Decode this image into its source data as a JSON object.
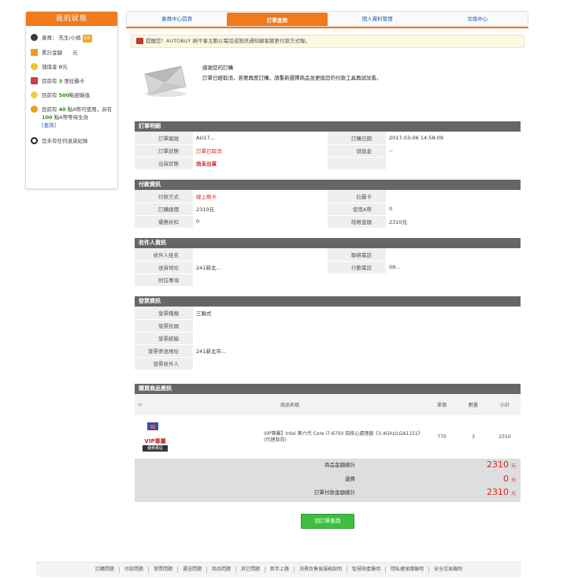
{
  "sidebar": {
    "title": "我的狀態",
    "member_prefix": "會員：",
    "member_name": "先生/小姐",
    "vip_badge": "VIP",
    "total_amount_label": "累計金額",
    "total_amount_unit": "元",
    "stored_value_label": "儲值金",
    "stored_value_amount": "0",
    "stored_value_unit": "元",
    "coupon_prefix": "目前有",
    "coupon_count": "3",
    "coupon_suffix": "張拉霸卡",
    "bonus_prefix": "目前有",
    "bonus_count": "500",
    "bonus_suffix": "點經驗值",
    "apoint_prefix": "目前有",
    "apoint_count": "40",
    "apoint_mid": "點A幣可使用，另有",
    "apoint_pending": "100",
    "apoint_suffix": "點A幣等待生效",
    "apoint_link": "[查詢]",
    "return_text": "您未有任何退貨紀錄"
  },
  "tabs": [
    {
      "label": "會員中心首頁"
    },
    {
      "label": "訂單查詢"
    },
    {
      "label": "個人資料管理"
    },
    {
      "label": "兌換中心"
    }
  ],
  "notice": "提醒您！AUTOBUY 絕不會主動以電話或簡訊通知顧客變更付款方式喔。",
  "thanks": {
    "line1": "感謝您的訂購",
    "line2": "訂單已經取消，若要再度訂購，請重新選擇商品並更換您的付款工具再試試看。"
  },
  "order_detail": {
    "title": "訂單明細",
    "rows": [
      {
        "l1": "訂單編號",
        "v1": "AU17...",
        "l2": "訂購日期",
        "v2": "2017-03-06 14:58:09"
      },
      {
        "l1": "訂單狀態",
        "v1": "訂單已取消",
        "l2": "儲值金",
        "v2": "--"
      },
      {
        "l1": "出貨狀態",
        "v1": "尚未出貨",
        "l2": "",
        "v2": ""
      }
    ]
  },
  "payment": {
    "title": "付款資訊",
    "rows": [
      {
        "l1": "付款方式",
        "v1": "線上刷卡",
        "l2": "拉霸卡",
        "v2": ""
      },
      {
        "l1": "訂購總價",
        "v1": "2310元",
        "l2": "使用A幣",
        "v2": "0"
      },
      {
        "l1": "優惠折扣",
        "v1": "0",
        "l2": "結帳金額",
        "v2": "2310元"
      }
    ]
  },
  "recipient": {
    "title": "收件人資訊",
    "name_label": "收件人姓名",
    "name_value": "",
    "phone_label": "聯絡電話",
    "phone_value": "",
    "address_label": "送貨地址",
    "address_value": "241新北...",
    "mobile_label": "行動電話",
    "mobile_value": "09...",
    "note_label": "附註事項",
    "note_value": ""
  },
  "invoice": {
    "title": "發票資訊",
    "rows": [
      {
        "label": "發票種類",
        "value": "三聯式"
      },
      {
        "label": "發票抬頭",
        "value": ""
      },
      {
        "label": "發票統編",
        "value": ""
      },
      {
        "label": "發票寄送地址",
        "value": "241新北市..."
      },
      {
        "label": "發票收件人",
        "value": ""
      }
    ]
  },
  "products": {
    "title": "購買商品資訊",
    "headers": {
      "name": "商品名稱",
      "price": "單價",
      "qty": "數量",
      "subtotal": "小計"
    },
    "items": [
      {
        "name": "VIP專屬】Intel 第六代 Core i7-6700 四核心處理器《3.4Ghz/LGA1151》(代理商貨)",
        "price": "770",
        "qty": "3",
        "subtotal": "2310",
        "logo_text": "VIP專屬",
        "logo_sub": "優惠專區"
      }
    ],
    "total_label": "商品金額總計",
    "total_value": "2310",
    "shipping_label": "運費",
    "shipping_value": "0",
    "pay_total_label": "訂單付款金額總計",
    "pay_total_value": "2310",
    "unit": "元"
  },
  "back_button": "回訂單查詢",
  "footer": [
    "訂購問題",
    "付款問題",
    "發票問題",
    "運送問題",
    "商品問題",
    "其它問題",
    "新手上路",
    "消費及售後服務說明",
    "智慧財產聲明",
    "隱私權保護聲明",
    "安全交易機制"
  ],
  "colors": {
    "accent": "#f07a1c",
    "section_head": "#666666",
    "price_red": "#e01e1e",
    "button_green": "#3fbf3f"
  }
}
